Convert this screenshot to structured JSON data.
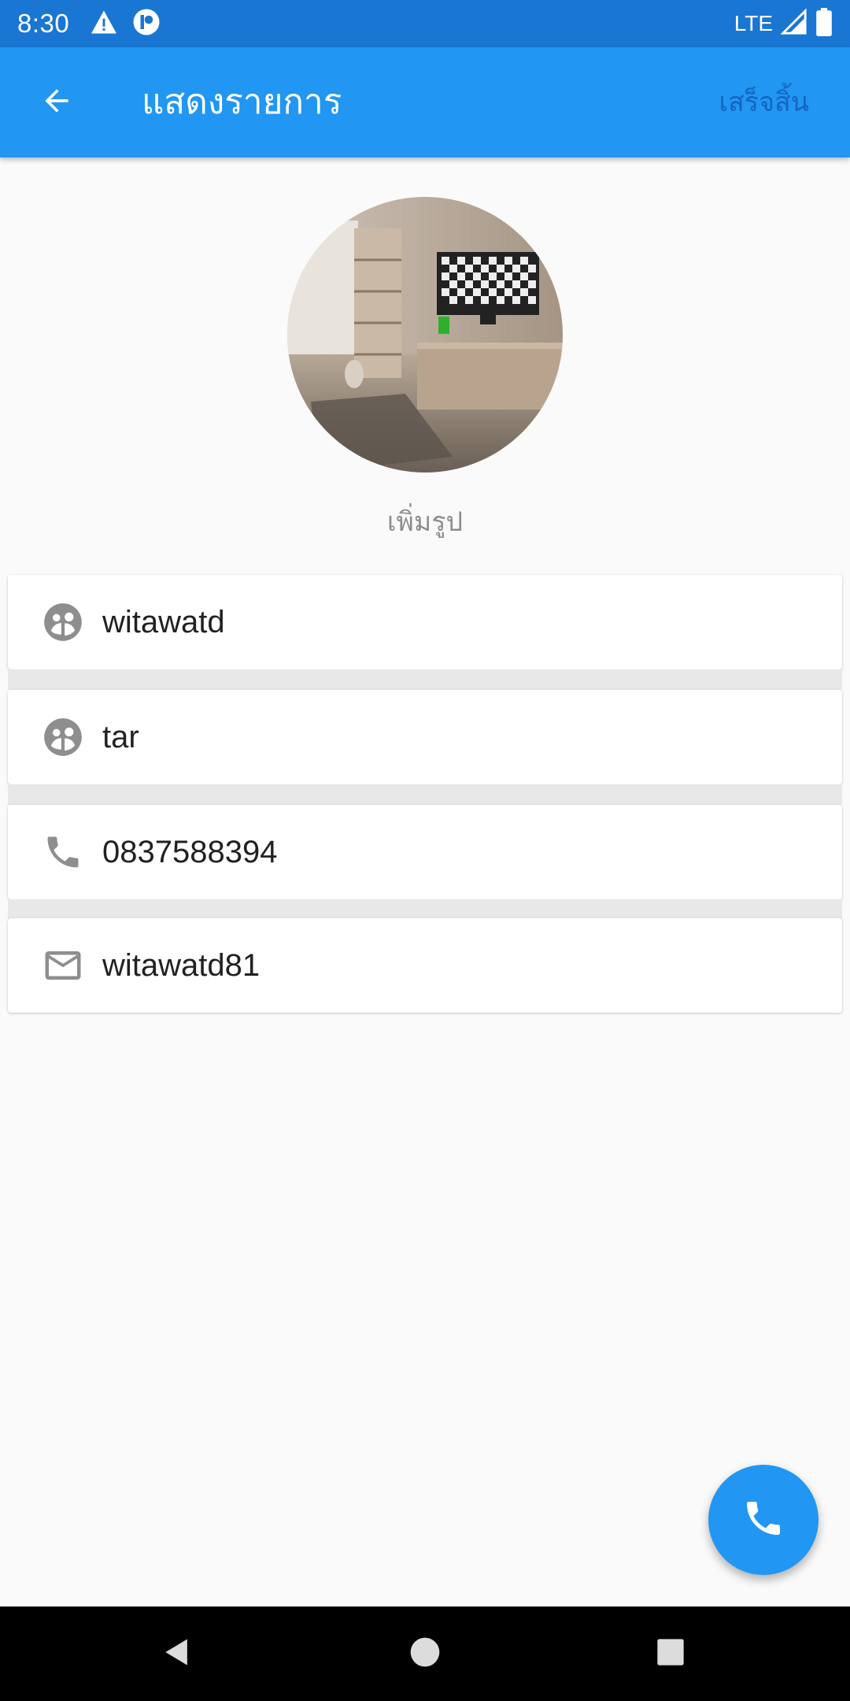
{
  "status_bar": {
    "time": "8:30",
    "network": "LTE",
    "icons": [
      "warning-icon",
      "notification-app-icon",
      "signal-icon",
      "battery-icon"
    ]
  },
  "app_bar": {
    "title": "แสดงรายการ",
    "done_label": "เสร็จสิ้น",
    "back_icon": "arrow-back-icon"
  },
  "profile": {
    "avatar_icon": "room-photo",
    "add_photo_label": "เพิ่มรูป"
  },
  "fields": [
    {
      "icon": "face-icon",
      "value": "witawatd"
    },
    {
      "icon": "face-icon",
      "value": "tar"
    },
    {
      "icon": "phone-icon",
      "value": "0837588394"
    },
    {
      "icon": "mail-icon",
      "value": "witawatd81"
    }
  ],
  "fab": {
    "icon": "phone-icon"
  },
  "nav_bar": {
    "icons": [
      "back-triangle-icon",
      "home-circle-icon",
      "recents-square-icon"
    ]
  },
  "colors": {
    "status_bar": "#1976d2",
    "app_bar": "#2196f3",
    "done_text": "#1565c0",
    "background": "#fafafa",
    "field_gap": "#e8e8e8",
    "icon_grey": "#8e8e8e",
    "fab": "#2196f3"
  }
}
